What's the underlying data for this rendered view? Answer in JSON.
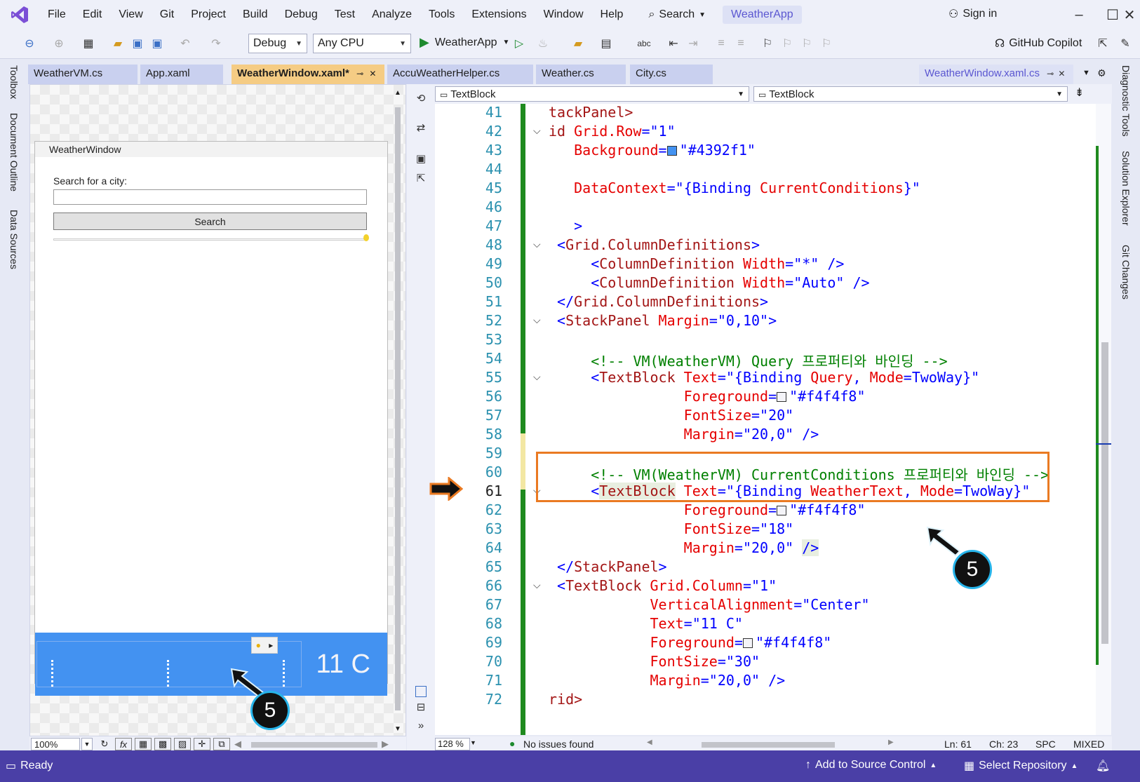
{
  "menu": {
    "items": [
      "File",
      "Edit",
      "View",
      "Git",
      "Project",
      "Build",
      "Debug",
      "Test",
      "Analyze",
      "Tools",
      "Extensions",
      "Window",
      "Help"
    ],
    "search_label": "Search",
    "app_title": "WeatherApp",
    "sign_in": "Sign in"
  },
  "toolbar": {
    "configuration": "Debug",
    "platform": "Any CPU",
    "run_target": "WeatherApp",
    "copilot": "GitHub Copilot"
  },
  "side_panels": {
    "left": [
      "Toolbox",
      "Document Outline",
      "Data Sources"
    ],
    "right": [
      "Diagnostic Tools",
      "Solution Explorer",
      "Git Changes"
    ]
  },
  "tabs": {
    "open": [
      "WeatherVM.cs",
      "App.xaml",
      "WeatherWindow.xaml*",
      "AccuWeatherHelper.cs",
      "Weather.cs",
      "City.cs"
    ],
    "active_index": 2,
    "preview": "WeatherWindow.xaml.cs"
  },
  "designer": {
    "window_title": "WeatherWindow",
    "search_label": "Search for a city:",
    "search_value": "",
    "search_button": "Search",
    "temperature": "11 C",
    "panel_color": "#4392f1",
    "zoom": "100%"
  },
  "editor": {
    "nav_left": "TextBlock",
    "nav_right": "TextBlock",
    "zoom": "128 %",
    "issues": "No issues found",
    "line": "Ln: 61",
    "col": "Ch: 23",
    "spc": "SPC",
    "eol": "MIXED",
    "current_line": 61,
    "line_numbers": [
      "41",
      "42",
      "43",
      "44",
      "45",
      "46",
      "47",
      "48",
      "49",
      "50",
      "51",
      "52",
      "53",
      "54",
      "55",
      "56",
      "57",
      "58",
      "59",
      "60",
      "61",
      "62",
      "63",
      "64",
      "65",
      "66",
      "67",
      "68",
      "69",
      "70",
      "71",
      "72"
    ],
    "code": {
      "l41": "tackPanel>",
      "l42a": "id ",
      "l42b": "Grid.Row",
      "l42c": "=\"1\"",
      "l43a": "   Background",
      "l43b": "=",
      "l43c": "\"#4392f1\"",
      "l45a": "   DataContext",
      "l45b": "=\"{Binding ",
      "l45c": "CurrentConditions",
      "l45d": "}\"",
      "l47": "   >",
      "l48a": " <",
      "l48b": "Grid.ColumnDefinitions",
      "l48c": ">",
      "l49a": "     <",
      "l49b": "ColumnDefinition",
      "l49c": " Width",
      "l49d": "=\"*\" />",
      "l50a": "     <",
      "l50b": "ColumnDefinition",
      "l50c": " Width",
      "l50d": "=\"Auto\" />",
      "l51a": " </",
      "l51b": "Grid.ColumnDefinitions",
      "l51c": ">",
      "l52a": " <",
      "l52b": "StackPanel",
      "l52c": " Margin",
      "l52d": "=\"0,10\">",
      "l54": "     <!-- VM(WeatherVM) Query 프로퍼티와 바인딩 -->",
      "l55a": "     <",
      "l55b": "TextBlock",
      "l55c": " Text",
      "l55d": "=\"{Binding ",
      "l55e": "Query",
      "l55f": ", ",
      "l55g": "Mode",
      "l55h": "=TwoWay}\"",
      "l56a": "                Foreground",
      "l56b": "=",
      "l56c": "\"#f4f4f8\"",
      "l57a": "                FontSize",
      "l57b": "=\"20\"",
      "l58a": "                Margin",
      "l58b": "=\"20,0\" />",
      "l60": "     <!-- VM(WeatherVM) CurrentConditions 프로퍼티와 바인딩 -->",
      "l61a": "     <",
      "l61b": "TextBlock",
      "l61c": " Text",
      "l61d": "=\"{Binding ",
      "l61e": "WeatherText",
      "l61f": ", ",
      "l61g": "Mode",
      "l61h": "=TwoWay}\"",
      "l62a": "                Foreground",
      "l62b": "=",
      "l62c": "\"#f4f4f8\"",
      "l63a": "                FontSize",
      "l63b": "=\"18\"",
      "l64a": "                Margin",
      "l64b": "=\"20,0\" ",
      "l64c": "/>",
      "l65a": " </",
      "l65b": "StackPanel",
      "l65c": ">",
      "l66a": " <",
      "l66b": "TextBlock",
      "l66c": " Grid.Column",
      "l66d": "=\"1\"",
      "l67a": "            VerticalAlignment",
      "l67b": "=\"Center\"",
      "l68a": "            Text",
      "l68b": "=\"11 C\"",
      "l69a": "            Foreground",
      "l69b": "=",
      "l69c": "\"#f4f4f8\"",
      "l70a": "            FontSize",
      "l70b": "=\"30\"",
      "l71a": "            Margin",
      "l71b": "=\"20,0\" />",
      "l72": "rid>"
    }
  },
  "annotations": {
    "badge_number": "5"
  },
  "statusbar": {
    "ready": "Ready",
    "source_control": "Add to Source Control",
    "repository": "Select Repository"
  },
  "colors": {
    "accent": "#5b57d1",
    "statusbar": "#4a3fa6",
    "highlight": "#ea7a22",
    "badge_ring": "#27b4ea"
  }
}
